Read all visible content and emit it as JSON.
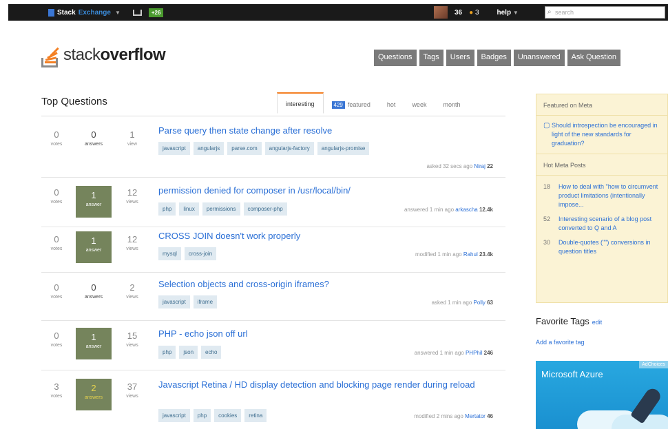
{
  "topbar": {
    "site_name_a": "Stack",
    "site_name_b": "Exchange",
    "rep_badge": "+26",
    "reputation": "36",
    "bronze_count": "3",
    "help": "help",
    "search_placeholder": "search"
  },
  "header": {
    "logo_light": "stack",
    "logo_bold": "overflow",
    "nav": [
      "Questions",
      "Tags",
      "Users",
      "Badges",
      "Unanswered",
      "Ask Question"
    ]
  },
  "questions_header": {
    "title": "Top Questions",
    "tabs": {
      "interesting": "interesting",
      "featured_count": "429",
      "featured": "featured",
      "hot": "hot",
      "week": "week",
      "month": "month"
    }
  },
  "questions": [
    {
      "votes": "0",
      "votes_label": "votes",
      "answers": "0",
      "answers_label": "answers",
      "views": "1",
      "views_label": "view",
      "title": "Parse query then state change after resolve",
      "tags": [
        "javascript",
        "angularjs",
        "parse.com",
        "angularjs-factory",
        "angularjs-promise"
      ],
      "action": "asked 32 secs ago",
      "user": "Niraj",
      "rep": "22"
    },
    {
      "votes": "0",
      "votes_label": "votes",
      "answers": "1",
      "answers_label": "answer",
      "views": "12",
      "views_label": "views",
      "title": "permission denied for composer in /usr/local/bin/",
      "tags": [
        "php",
        "linux",
        "permissions",
        "composer-php"
      ],
      "action": "answered 1 min ago",
      "user": "arkascha",
      "rep": "12.4k"
    },
    {
      "votes": "0",
      "votes_label": "votes",
      "answers": "1",
      "answers_label": "answer",
      "views": "12",
      "views_label": "views",
      "title": "CROSS JOIN doesn't work properly",
      "tags": [
        "mysql",
        "cross-join"
      ],
      "action": "modified 1 min ago",
      "user": "Rahul",
      "rep": "23.4k"
    },
    {
      "votes": "0",
      "votes_label": "votes",
      "answers": "0",
      "answers_label": "answers",
      "views": "2",
      "views_label": "views",
      "title": "Selection objects and cross-origin iframes?",
      "tags": [
        "javascript",
        "iframe"
      ],
      "action": "asked 1 min ago",
      "user": "Polly",
      "rep": "63"
    },
    {
      "votes": "0",
      "votes_label": "votes",
      "answers": "1",
      "answers_label": "answer",
      "views": "15",
      "views_label": "views",
      "title": "PHP - echo json off url",
      "tags": [
        "php",
        "json",
        "echo"
      ],
      "action": "answered 1 min ago",
      "user": "PHPhil",
      "rep": "246"
    },
    {
      "votes": "3",
      "votes_label": "votes",
      "answers": "2",
      "answers_label": "answers",
      "views": "37",
      "views_label": "views",
      "title": "Javascript Retina / HD display detection and blocking page render during reload",
      "tags": [
        "javascript",
        "php",
        "cookies",
        "retina"
      ],
      "action": "modified 2 mins ago",
      "user": "Mertator",
      "rep": "46"
    }
  ],
  "sidebar": {
    "featured_head": "Featured on Meta",
    "featured_items": [
      {
        "text": "Should introspection be encouraged in light of the new standards for graduation?"
      }
    ],
    "hot_head": "Hot Meta Posts",
    "hot_items": [
      {
        "count": "18",
        "text": "How to deal with \"how to circumvent product limitations (intentionally impose..."
      },
      {
        "count": "52",
        "text": "Interesting scenario of a blog post converted to Q and A"
      },
      {
        "count": "30",
        "text": "Double-quotes (\"\") conversions in question titles"
      }
    ],
    "fav_title": "Favorite Tags",
    "fav_edit": "edit",
    "fav_add": "Add a favorite tag",
    "ad_title": "Microsoft Azure",
    "ad_badge": "AdChoices"
  }
}
